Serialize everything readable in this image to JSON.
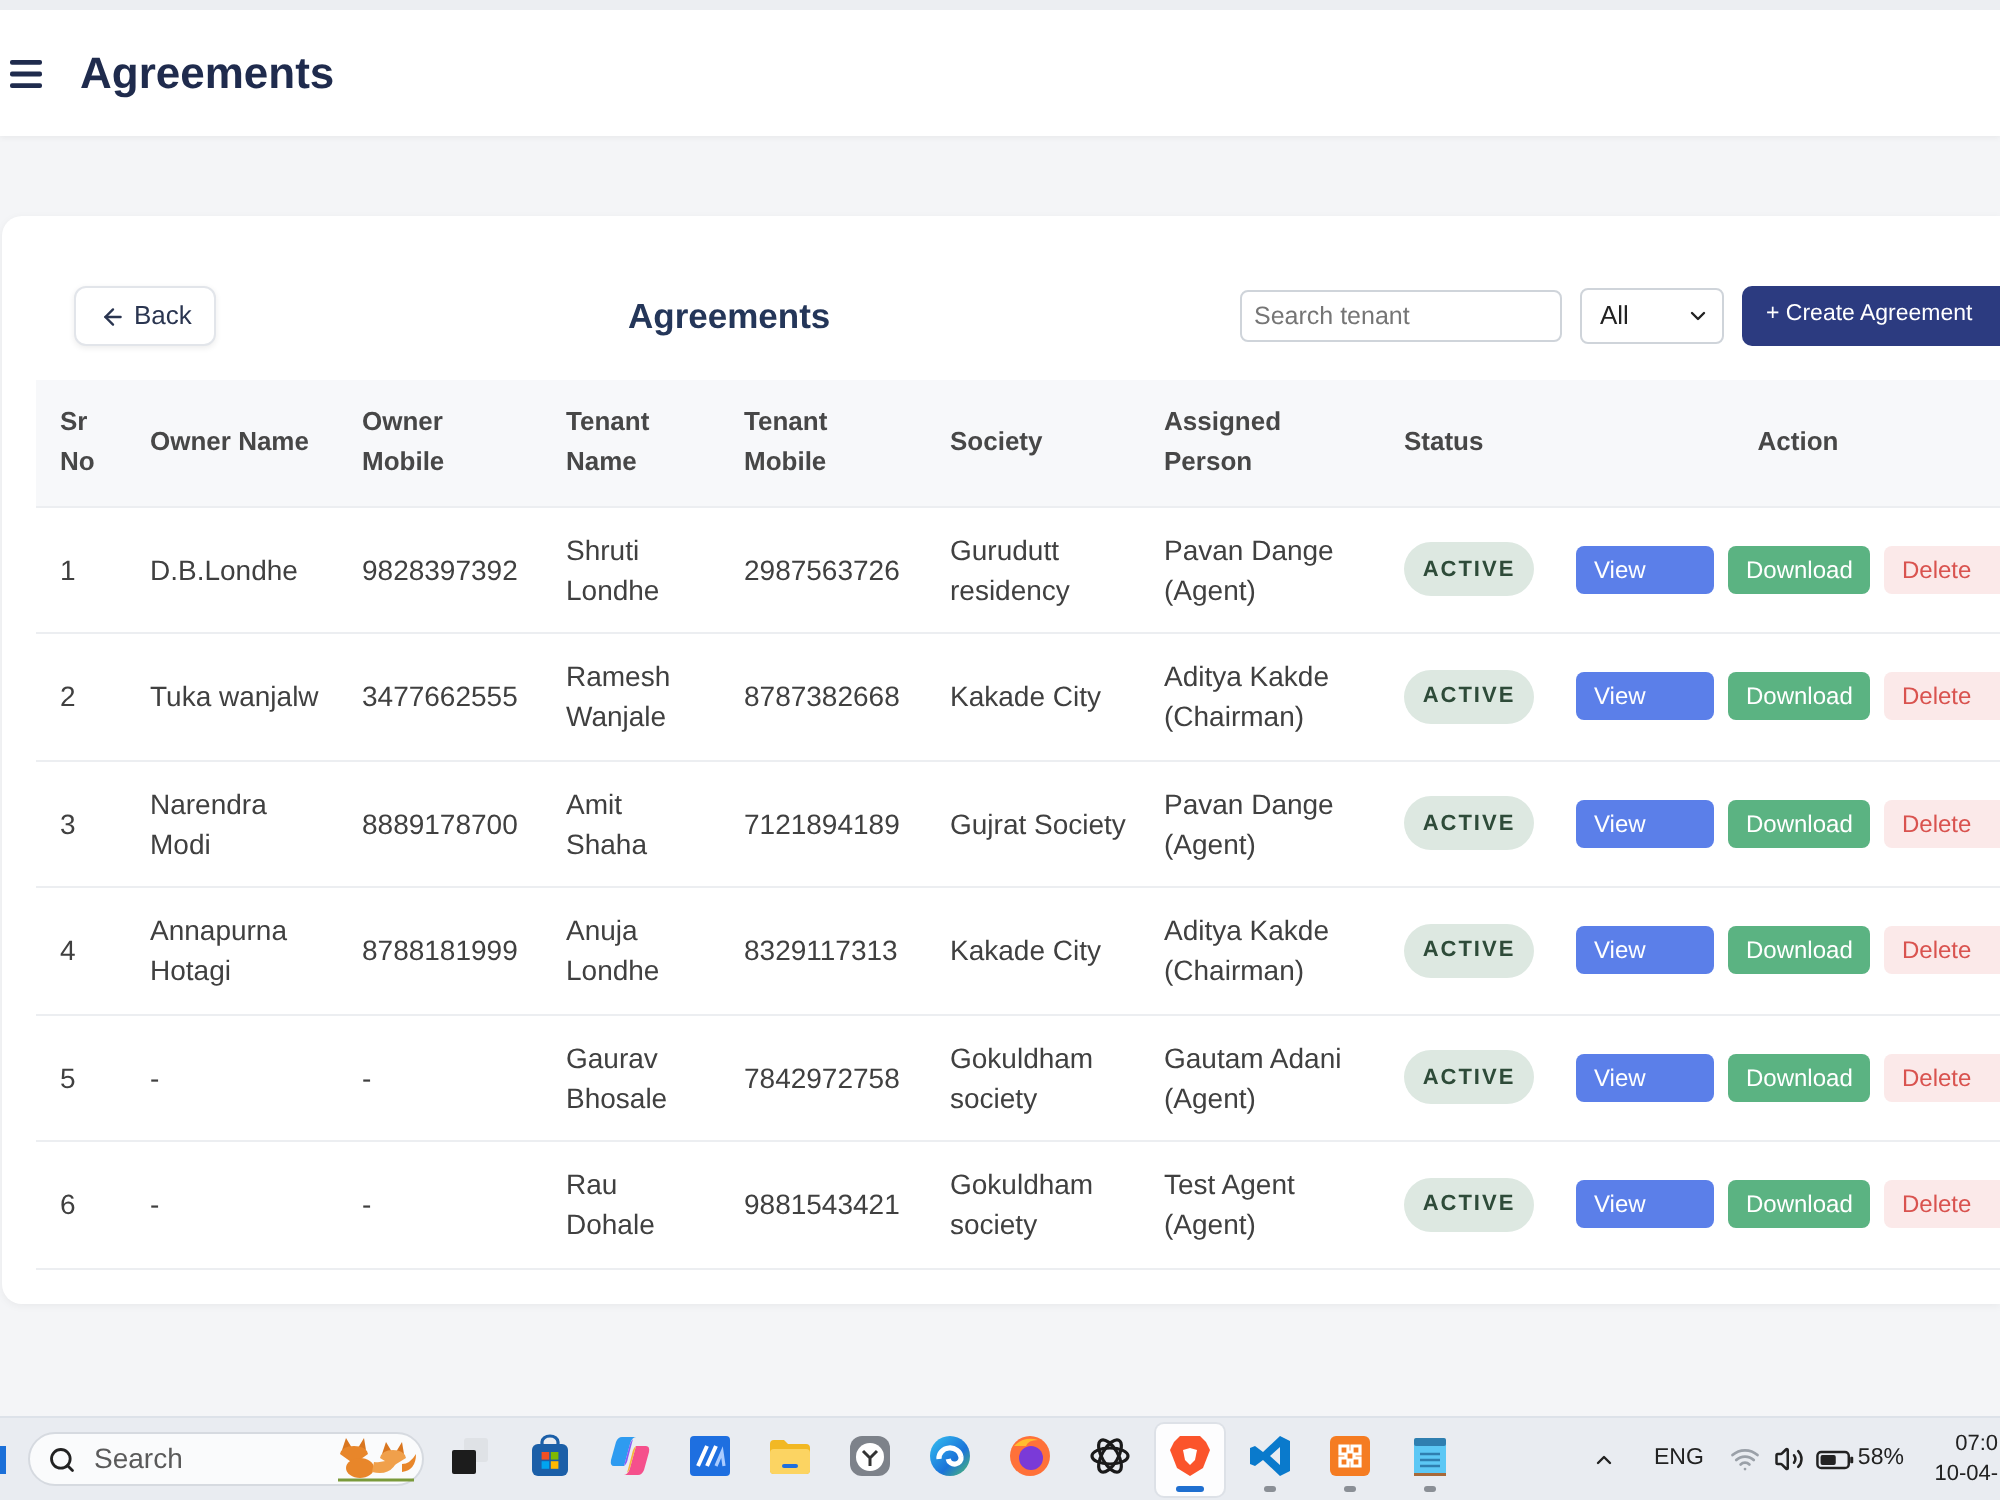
{
  "header": {
    "title": "Agreements"
  },
  "page": {
    "back_button": "Back",
    "title": "Agreements",
    "search": {
      "placeholder": "Search tenant"
    },
    "filter": {
      "value": "All"
    },
    "create_button": "+ Create Agreement"
  },
  "table": {
    "columns": [
      "Sr No",
      "Owner Name",
      "Owner Mobile",
      "Tenant Name",
      "Tenant Mobile",
      "Society",
      "Assigned Person",
      "Status",
      "Action"
    ],
    "rows": [
      {
        "sr_no": "1",
        "owner_name": "D.B.Londhe",
        "owner_mobile": "9828397392",
        "tenant_name": "Shruti Londhe",
        "tenant_mobile": "2987563726",
        "society": "Gurudutt residency",
        "assigned_person": "Pavan Dange (Agent)",
        "status": "ACTIVE",
        "actions": [
          {
            "kind": "view",
            "label": "View"
          },
          {
            "kind": "download",
            "label": "Download"
          },
          {
            "kind": "delete",
            "label": "Delete"
          }
        ]
      },
      {
        "sr_no": "2",
        "owner_name": "Tuka wanjalw",
        "owner_mobile": "3477662555",
        "tenant_name": "Ramesh Wanjale",
        "tenant_mobile": "8787382668",
        "society": "Kakade City",
        "assigned_person": "Aditya Kakde (Chairman)",
        "status": "ACTIVE",
        "actions": [
          {
            "kind": "view",
            "label": "View"
          },
          {
            "kind": "download",
            "label": "Download"
          },
          {
            "kind": "delete",
            "label": "Delete"
          }
        ]
      },
      {
        "sr_no": "3",
        "owner_name": "Narendra Modi",
        "owner_mobile": "8889178700",
        "tenant_name": "Amit Shaha",
        "tenant_mobile": "7121894189",
        "society": "Gujrat Society",
        "assigned_person": "Pavan Dange (Agent)",
        "status": "ACTIVE",
        "actions": [
          {
            "kind": "view",
            "label": "View"
          },
          {
            "kind": "download",
            "label": "Download"
          },
          {
            "kind": "delete",
            "label": "Delete"
          }
        ]
      },
      {
        "sr_no": "4",
        "owner_name": "Annapurna Hotagi",
        "owner_mobile": "8788181999",
        "tenant_name": "Anuja Londhe",
        "tenant_mobile": "8329117313",
        "society": "Kakade City",
        "assigned_person": "Aditya Kakde (Chairman)",
        "status": "ACTIVE",
        "actions": [
          {
            "kind": "view",
            "label": "View"
          },
          {
            "kind": "download",
            "label": "Download"
          },
          {
            "kind": "delete",
            "label": "Delete"
          }
        ]
      },
      {
        "sr_no": "5",
        "owner_name": "-",
        "owner_mobile": "-",
        "tenant_name": "Gaurav Bhosale",
        "tenant_mobile": "7842972758",
        "society": "Gokuldham society",
        "assigned_person": "Gautam Adani (Agent)",
        "status": "ACTIVE",
        "actions": [
          {
            "kind": "view",
            "label": "View"
          },
          {
            "kind": "download",
            "label": "Download"
          },
          {
            "kind": "delete",
            "label": "Delete"
          }
        ]
      },
      {
        "sr_no": "6",
        "owner_name": "-",
        "owner_mobile": "-",
        "tenant_name": "Rau Dohale",
        "tenant_mobile": "9881543421",
        "society": "Gokuldham society",
        "assigned_person": "Test Agent (Agent)",
        "status": "ACTIVE",
        "actions": [
          {
            "kind": "view",
            "label": "View"
          },
          {
            "kind": "download",
            "label": "Download"
          },
          {
            "kind": "delete",
            "label": "Delete"
          }
        ]
      }
    ]
  },
  "taskbar": {
    "search": {
      "placeholder": "Search"
    },
    "apps": [
      {
        "kind": "task-view",
        "running": false,
        "selected": false
      },
      {
        "kind": "store",
        "running": false,
        "selected": false
      },
      {
        "kind": "assistant",
        "running": false,
        "selected": false
      },
      {
        "kind": "tile",
        "running": false,
        "selected": false
      },
      {
        "kind": "folder",
        "running": false,
        "selected": false
      },
      {
        "kind": "clock",
        "running": false,
        "selected": false
      },
      {
        "kind": "browser-wave",
        "running": false,
        "selected": false
      },
      {
        "kind": "browser-globe",
        "running": false,
        "selected": false
      },
      {
        "kind": "chat",
        "running": false,
        "selected": false
      },
      {
        "kind": "browser-shield",
        "running": true,
        "selected": true
      },
      {
        "kind": "editor",
        "running": true,
        "selected": false
      },
      {
        "kind": "server",
        "running": true,
        "selected": false
      },
      {
        "kind": "notepad",
        "running": true,
        "selected": false
      }
    ],
    "tray": {
      "language": "ENG",
      "battery": "58%",
      "time": "07:0",
      "date": "10-04-"
    }
  }
}
